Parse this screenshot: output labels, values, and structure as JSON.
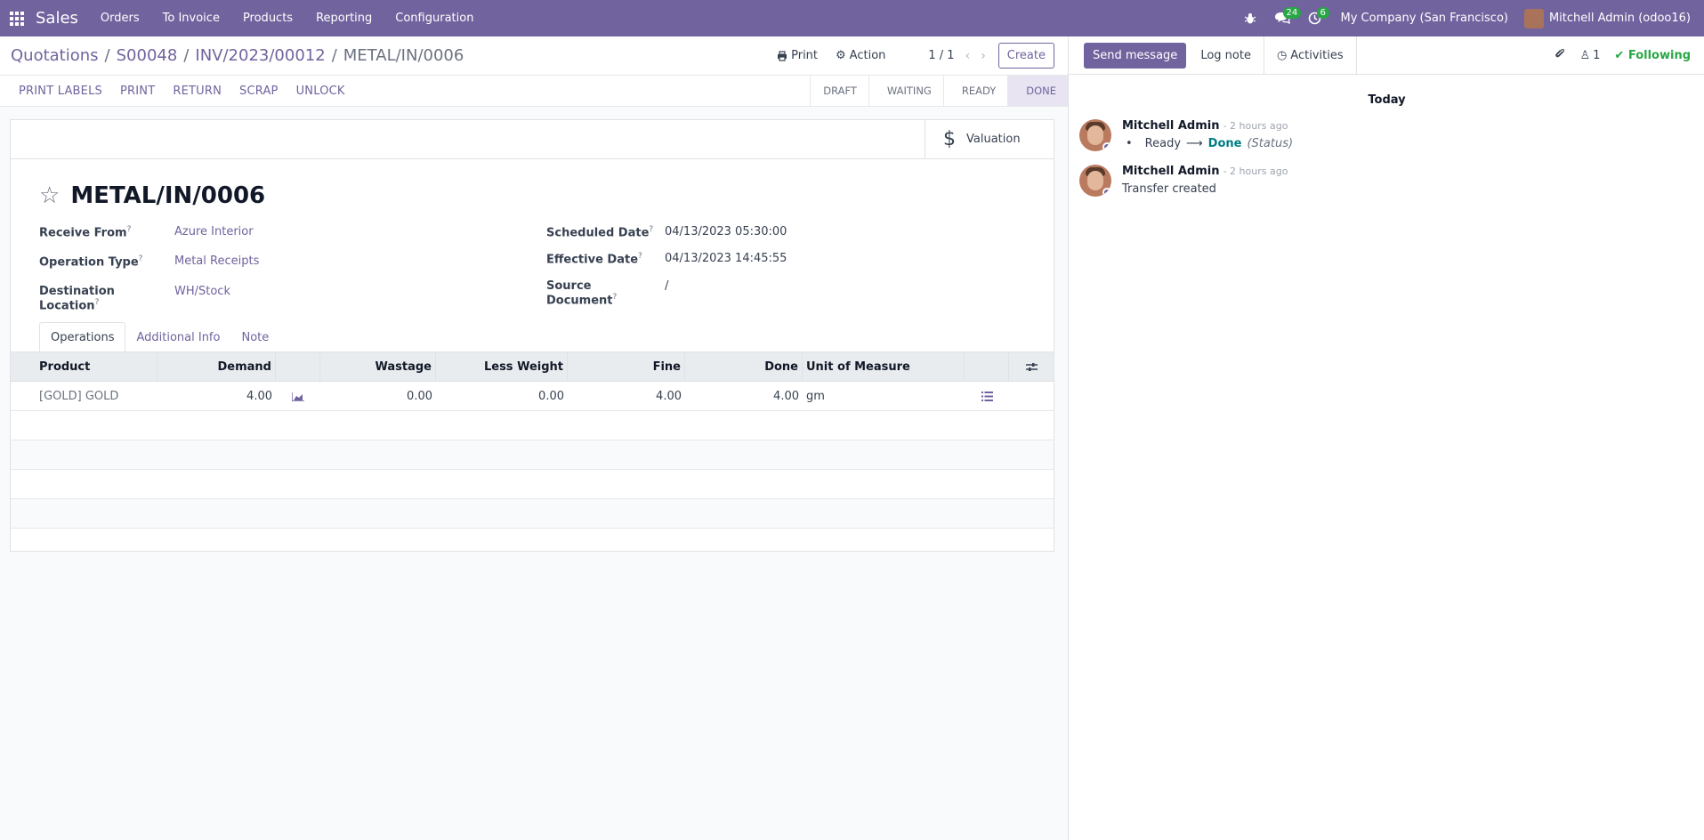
{
  "navbar": {
    "brand": "Sales",
    "menu": [
      "Orders",
      "To Invoice",
      "Products",
      "Reporting",
      "Configuration"
    ],
    "messages_count": "24",
    "activities_count": "6",
    "company": "My Company (San Francisco)",
    "user": "Mitchell Admin (odoo16)"
  },
  "breadcrumb": {
    "items": [
      "Quotations",
      "S00048",
      "INV/2023/00012"
    ],
    "current": "METAL/IN/0006"
  },
  "control": {
    "print": "Print",
    "action": "Action",
    "pager": "1 / 1",
    "create": "Create"
  },
  "header_buttons": [
    "PRINT LABELS",
    "PRINT",
    "RETURN",
    "SCRAP",
    "UNLOCK"
  ],
  "stages": [
    "DRAFT",
    "WAITING",
    "READY",
    "DONE"
  ],
  "active_stage": "DONE",
  "valuation_label": "Valuation",
  "record": {
    "name": "METAL/IN/0006",
    "receive_from_label": "Receive From",
    "receive_from": "Azure Interior",
    "operation_type_label": "Operation Type",
    "operation_type": "Metal Receipts",
    "destination_label": "Destination Location",
    "destination": "WH/Stock",
    "scheduled_label": "Scheduled Date",
    "scheduled": "04/13/2023 05:30:00",
    "effective_label": "Effective Date",
    "effective": "04/13/2023 14:45:55",
    "source_label": "Source Document",
    "source": "/"
  },
  "tabs": [
    "Operations",
    "Additional Info",
    "Note"
  ],
  "table": {
    "headers": [
      "Product",
      "Demand",
      "",
      "Wastage",
      "Less Weight",
      "Fine",
      "Done",
      "Unit of Measure"
    ],
    "rows": [
      {
        "product": "[GOLD] GOLD",
        "demand": "4.00",
        "wastage": "0.00",
        "less_weight": "0.00",
        "fine": "4.00",
        "done": "4.00",
        "uom": "gm"
      }
    ]
  },
  "chatter": {
    "send_message": "Send message",
    "log_note": "Log note",
    "activities": "Activities",
    "followers_count": "1",
    "following": "Following",
    "today": "Today",
    "messages": [
      {
        "author": "Mitchell Admin",
        "time": "- 2 hours ago",
        "from": "Ready",
        "to": "Done",
        "field": "(Status)"
      },
      {
        "author": "Mitchell Admin",
        "time": "- 2 hours ago",
        "body": "Transfer created"
      }
    ]
  },
  "colors": {
    "brand": "#71639e",
    "following": "#28a745",
    "status_done": "#017e84"
  }
}
